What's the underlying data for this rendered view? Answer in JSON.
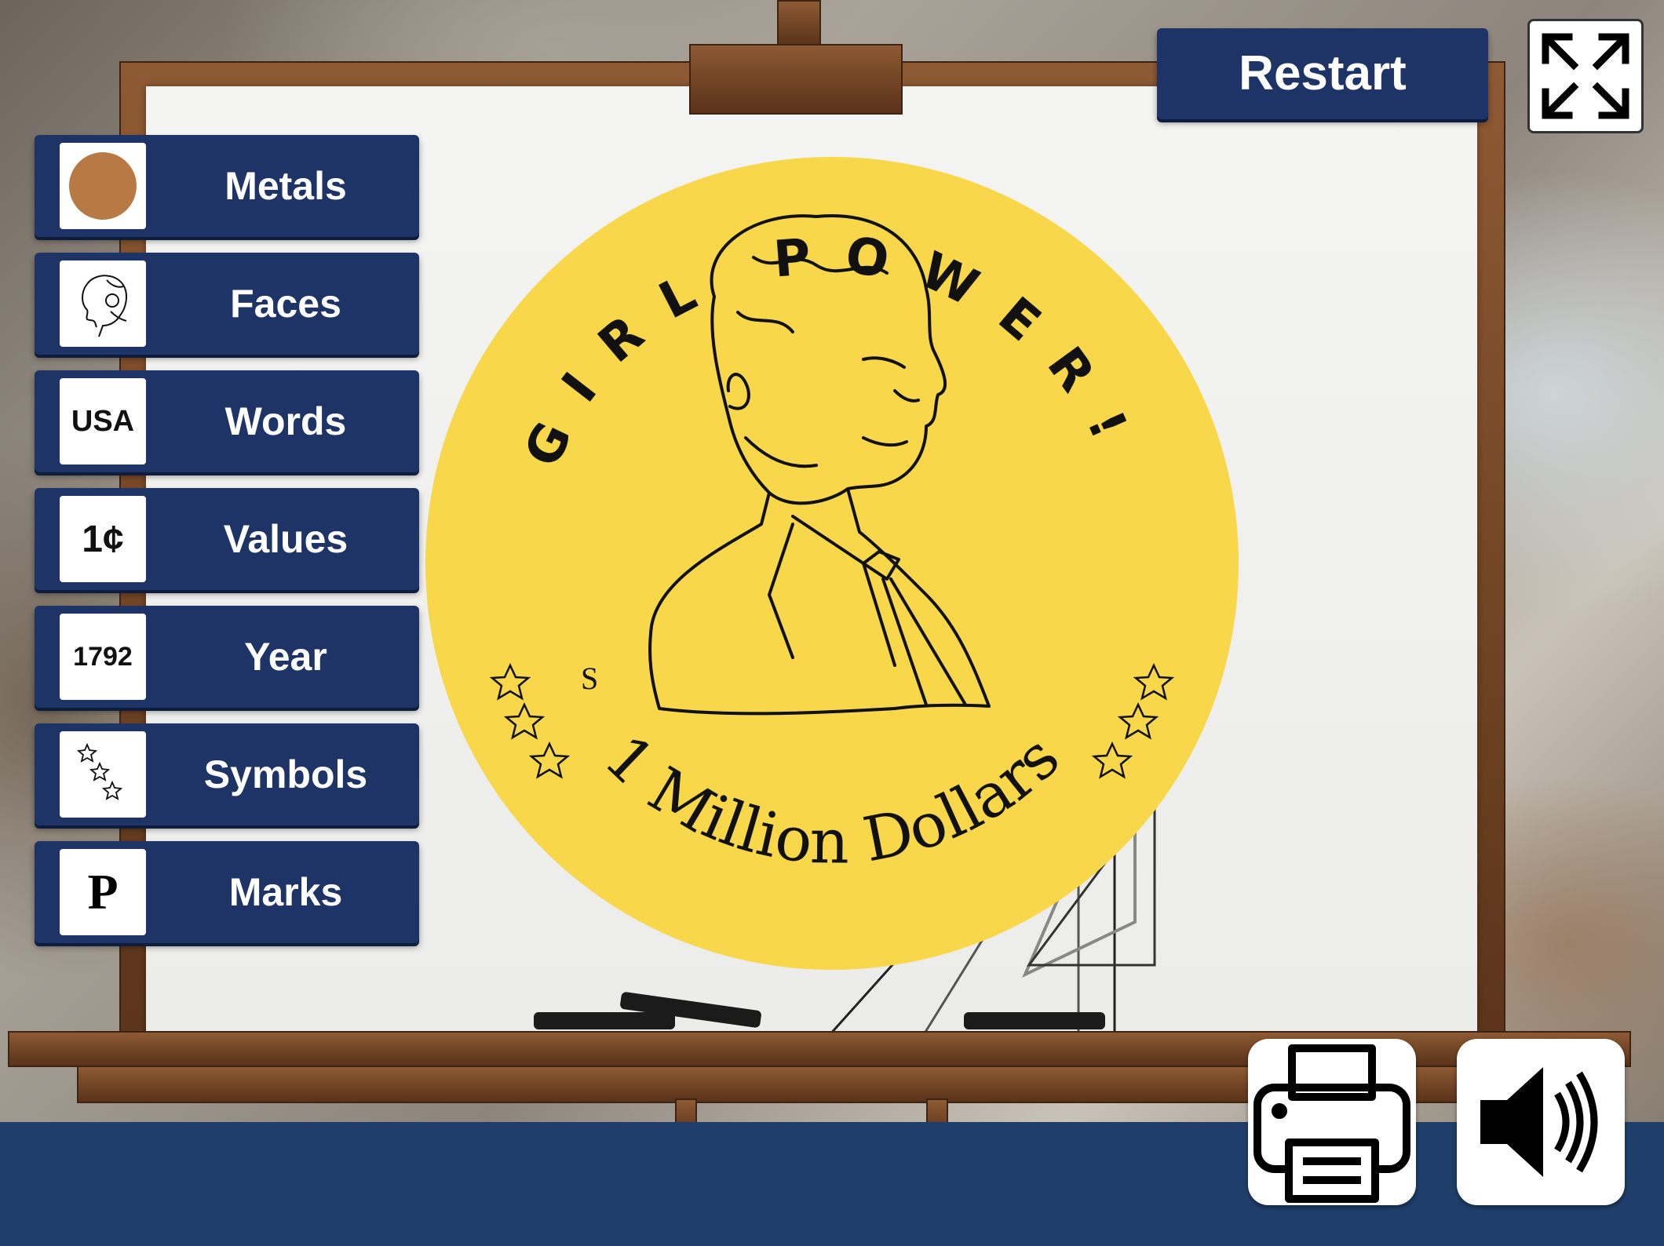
{
  "toolbar": {
    "restart_label": "Restart",
    "fullscreen_icon": "fullscreen-expand-icon",
    "print_icon": "printer-icon",
    "sound_icon": "speaker-icon"
  },
  "sidebar": {
    "items": [
      {
        "label": "Metals",
        "thumb": "",
        "icon": "copper-circle-icon"
      },
      {
        "label": "Faces",
        "thumb": "",
        "icon": "portrait-icon"
      },
      {
        "label": "Words",
        "thumb": "USA",
        "icon": ""
      },
      {
        "label": "Values",
        "thumb": "1¢",
        "icon": ""
      },
      {
        "label": "Year",
        "thumb": "1792",
        "icon": ""
      },
      {
        "label": "Symbols",
        "thumb": "",
        "icon": "stars-icon"
      },
      {
        "label": "Marks",
        "thumb": "P",
        "icon": ""
      }
    ]
  },
  "coin": {
    "top_text": "GIRL POWER!",
    "bottom_text": "1 Million Dollars",
    "mint_mark": "S",
    "metal_color": "#f8d84a",
    "portrait_icon": "lincoln-portrait-icon"
  },
  "colors": {
    "button_bg": "#1e3466",
    "bottom_bar": "#1f3f6a",
    "copper": "#b87a44"
  }
}
